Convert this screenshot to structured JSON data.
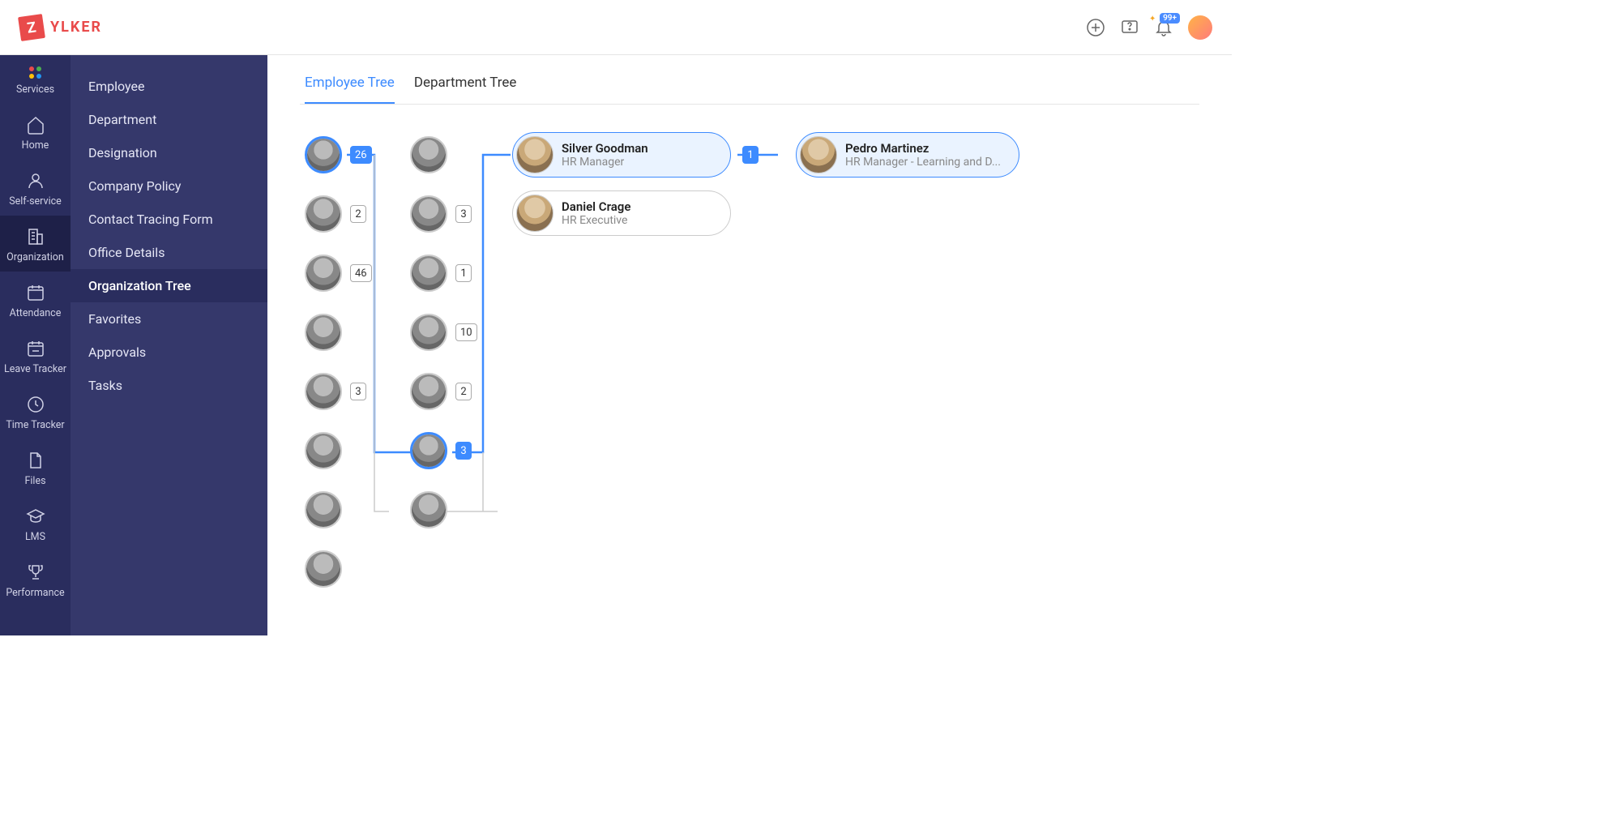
{
  "brand": {
    "badge": "Z",
    "name": "YLKER"
  },
  "header": {
    "notification_count": "99+"
  },
  "nav_primary": [
    {
      "id": "services",
      "label": "Services",
      "icon": "grid-dots"
    },
    {
      "id": "home",
      "label": "Home",
      "icon": "home"
    },
    {
      "id": "self-service",
      "label": "Self-service",
      "icon": "person"
    },
    {
      "id": "organization",
      "label": "Organization",
      "icon": "building",
      "active": true
    },
    {
      "id": "attendance",
      "label": "Attendance",
      "icon": "calendar"
    },
    {
      "id": "leave-tracker",
      "label": "Leave Tracker",
      "icon": "calendar-minus"
    },
    {
      "id": "time-tracker",
      "label": "Time Tracker",
      "icon": "clock"
    },
    {
      "id": "files",
      "label": "Files",
      "icon": "file"
    },
    {
      "id": "lms",
      "label": "LMS",
      "icon": "grad-cap"
    },
    {
      "id": "performance",
      "label": "Performance",
      "icon": "trophy"
    }
  ],
  "nav_secondary": [
    {
      "label": "Employee"
    },
    {
      "label": "Department"
    },
    {
      "label": "Designation"
    },
    {
      "label": "Company Policy"
    },
    {
      "label": "Contact Tracing Form"
    },
    {
      "label": "Office Details"
    },
    {
      "label": "Organization Tree",
      "active": true
    },
    {
      "label": "Favorites"
    },
    {
      "label": "Approvals"
    },
    {
      "label": "Tasks"
    }
  ],
  "tabs": [
    {
      "label": "Employee Tree",
      "active": true
    },
    {
      "label": "Department Tree"
    }
  ],
  "tree": {
    "col1": [
      {
        "count": "26",
        "selected": true
      },
      {
        "count": "2"
      },
      {
        "count": "46"
      },
      {},
      {
        "count": "3"
      },
      {},
      {},
      {}
    ],
    "col2": [
      {},
      {
        "count": "3"
      },
      {
        "count": "1"
      },
      {
        "count": "10"
      },
      {
        "count": "2"
      },
      {
        "count": "3",
        "selected": true
      },
      {}
    ],
    "col3": [
      {
        "name": "Silver Goodman",
        "role": "HR Manager",
        "selected": true,
        "count": "1"
      },
      {
        "name": "Daniel Crage",
        "role": "HR Executive"
      }
    ],
    "col4": [
      {
        "name": "Pedro Martinez",
        "role": "HR Manager - Learning and D...",
        "selected": true
      }
    ]
  }
}
